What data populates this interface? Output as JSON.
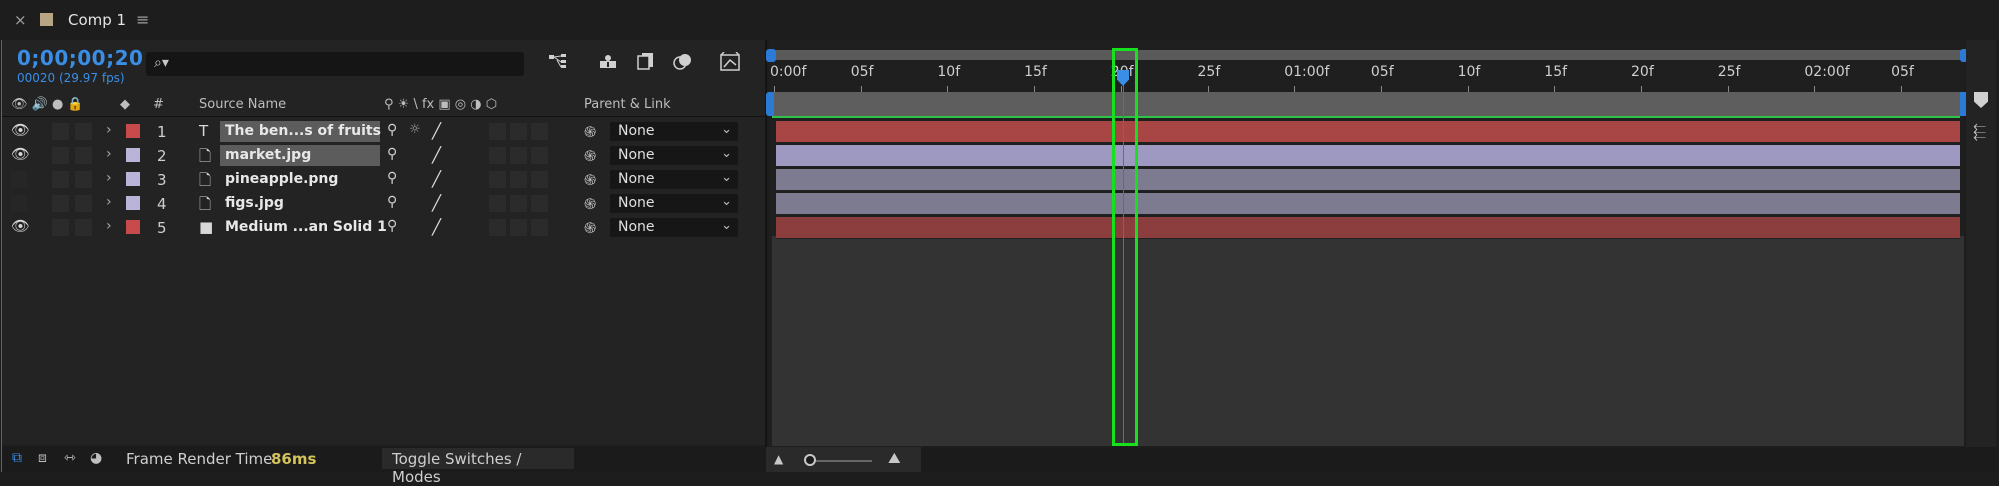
{
  "tab": {
    "close_icon": "×",
    "title": "Comp 1",
    "menu_icon": "≡",
    "swatch_color": "#b6a684"
  },
  "time": {
    "timecode": "0;00;00;20",
    "frame_info": "00020 (29.97 fps)"
  },
  "search": {
    "icon": "⌕▾",
    "placeholder": ""
  },
  "toolbar_icons": [
    "comp-mini-flowchart-icon",
    "draft-3d-icon",
    "frame-blending-icon",
    "motion-blur-icon",
    "graph-editor-icon"
  ],
  "columns": {
    "source_name": "Source Name",
    "number": "#",
    "parent_link": "Parent & Link",
    "switches": "⚲ ☀ \\ fx ▣ ◎ ◑ ⬡"
  },
  "layers": [
    {
      "num": "1",
      "type_icon": "T",
      "name": "The ben...s of fruits",
      "label_color": "#c94a4a",
      "eye": true,
      "selected": true,
      "parent": "None",
      "bar_color": "#a84646"
    },
    {
      "num": "2",
      "type_icon": "🗋",
      "name": "market.jpg",
      "label_color": "#b9b4d8",
      "eye": true,
      "selected": true,
      "parent": "None",
      "bar_color": "#9d99c0"
    },
    {
      "num": "3",
      "type_icon": "🗋",
      "name": "pineapple.png",
      "label_color": "#b9b4d8",
      "eye": false,
      "selected": false,
      "parent": "None",
      "bar_color": "#7d7b90"
    },
    {
      "num": "4",
      "type_icon": "🗋",
      "name": "figs.jpg",
      "label_color": "#b9b4d8",
      "eye": false,
      "selected": false,
      "parent": "None",
      "bar_color": "#7d7b90"
    },
    {
      "num": "5",
      "type_icon": "■",
      "name": "Medium ...an Solid 1",
      "label_color": "#c94a4a",
      "eye": true,
      "selected": false,
      "parent": "None",
      "bar_color": "#8c3e3e"
    }
  ],
  "ruler": {
    "labels": [
      "0:00f",
      "05f",
      "10f",
      "15f",
      "20f",
      "25f",
      "01:00f",
      "05f",
      "10f",
      "15f",
      "20f",
      "25f",
      "02:00f",
      "05f"
    ],
    "playhead_frame": 20
  },
  "bottom": {
    "frame_render_label": "Frame Render Time",
    "frame_render_value": "86ms",
    "toggle_label": "Toggle Switches / Modes"
  },
  "colors": {
    "accent": "#3a8ee6",
    "highlight_box": "#17e01f",
    "work_area_line": "#2ec44a"
  }
}
